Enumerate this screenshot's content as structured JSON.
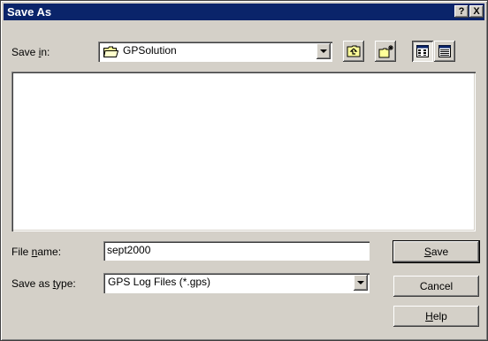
{
  "window": {
    "title": "Save As",
    "help_button": "?",
    "close_button": "X"
  },
  "save_in": {
    "label_prefix": "Save ",
    "label_mnemonic": "i",
    "label_suffix": "n:",
    "value": "GPSolution",
    "folder_icon": "folder-icon"
  },
  "toolbar": {
    "up_folder_icon": "up-one-level-icon",
    "new_folder_icon": "create-new-folder-icon",
    "list_view_icon": "list-view-icon",
    "details_view_icon": "details-view-icon"
  },
  "file_list": {
    "items": []
  },
  "file_name": {
    "label_prefix": "File ",
    "label_mnemonic": "n",
    "label_suffix": "ame:",
    "value": "sept2000"
  },
  "save_as_type": {
    "label_prefix": "Save as ",
    "label_mnemonic": "t",
    "label_suffix": "ype:",
    "value": "GPS Log Files (*.gps)"
  },
  "buttons": {
    "save_mnemonic": "S",
    "save_rest": "ave",
    "cancel": "Cancel",
    "help_mnemonic": "H",
    "help_rest": "elp"
  },
  "colors": {
    "titlebar": "#0a246a",
    "face": "#d4d0c8"
  }
}
